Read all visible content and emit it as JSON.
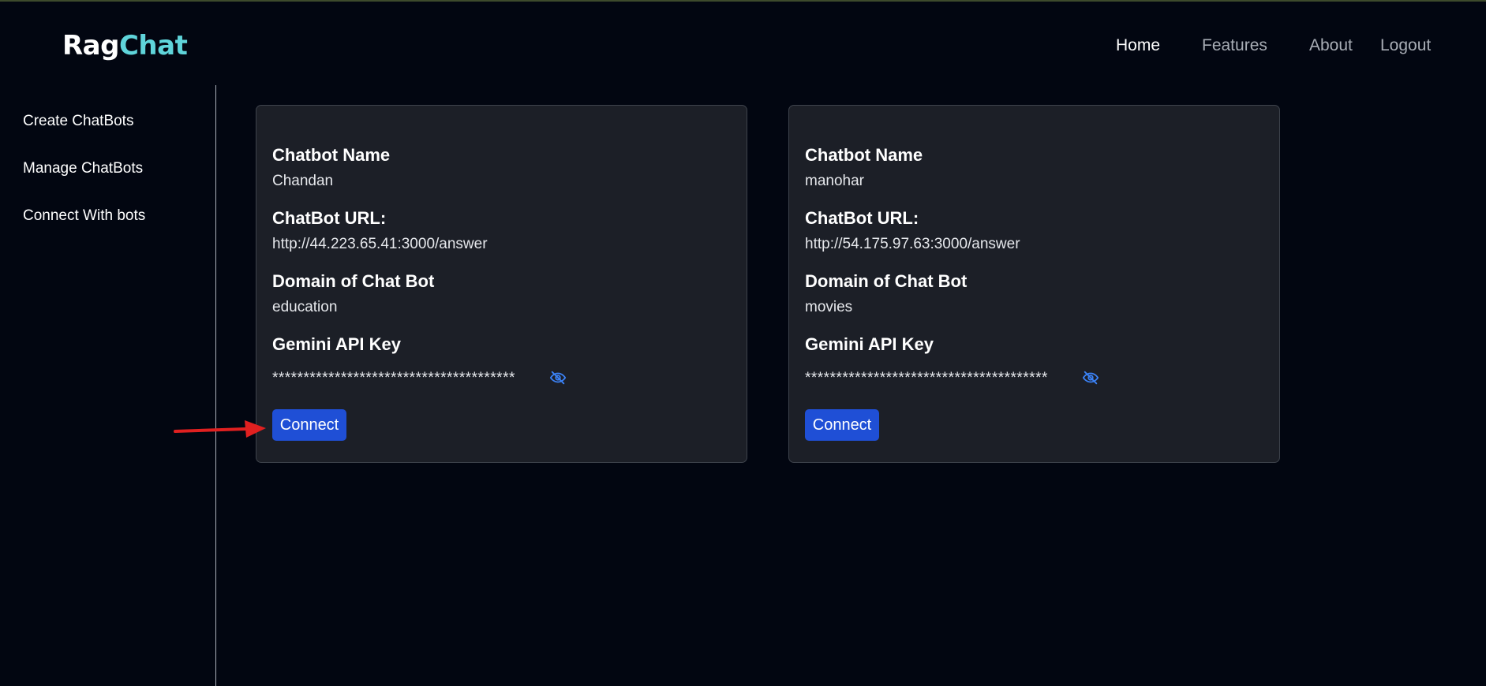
{
  "brand": {
    "part1": "Rag",
    "part2": "Chat"
  },
  "nav": [
    "Home",
    "Features",
    "About",
    "Logout"
  ],
  "sidebar": [
    "Create ChatBots",
    "Manage ChatBots",
    "Connect With bots"
  ],
  "cards": [
    {
      "name_label": "Chatbot Name",
      "name": "Chandan",
      "url_label": "ChatBot URL:",
      "url": "http://44.223.65.41:3000/answer",
      "domain_label": "Domain of Chat Bot",
      "domain": "education",
      "key_label": "Gemini API Key",
      "key": "***************************************",
      "button": "Connect"
    },
    {
      "name_label": "Chatbot Name",
      "name": "manohar",
      "url_label": "ChatBot URL:",
      "url": "http://54.175.97.63:3000/answer",
      "domain_label": "Domain of Chat Bot",
      "domain": "movies",
      "key_label": "Gemini API Key",
      "key": "***************************************",
      "button": "Connect"
    }
  ],
  "icons": {
    "toggle_visibility": "eye-slash-icon",
    "annotation": "red-arrow"
  },
  "colors": {
    "accent": "#1f4fd6",
    "brand_secondary": "#5fd4da",
    "annotation": "#e02020"
  }
}
